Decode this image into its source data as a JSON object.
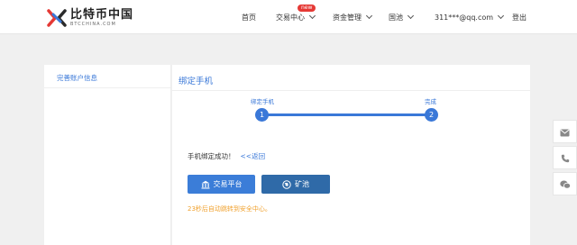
{
  "header": {
    "logo_cn": "比特币中国",
    "logo_en": "BTCCHINA.COM",
    "nav": {
      "home": "首页",
      "trade_center": "交易中心",
      "new_badge": "new",
      "asset_management": "资金管理",
      "pool": "国池",
      "account": "311***@qq.com",
      "logout": "登出"
    }
  },
  "sidebar": {
    "items": [
      {
        "label": "完善账户信息"
      }
    ]
  },
  "main": {
    "title": "绑定手机",
    "steps": [
      {
        "label": "绑定手机",
        "number": "1"
      },
      {
        "label": "完成",
        "number": "2"
      }
    ],
    "success_text": "手机绑定成功！",
    "back_link": "<<返回",
    "buttons": {
      "trade_platform": "交易平台",
      "mining_pool": "矿池"
    },
    "redirect_text": "23秒后自动跳转到安全中心。"
  },
  "colors": {
    "accent": "#3a78d8",
    "button_trade": "#3b7dd8",
    "button_pool": "#2f6aa8",
    "warning_text": "#f0a12e",
    "badge": "#e53935"
  },
  "icons": {
    "logo": "btcchina-x-logo",
    "trade_button": "bank-icon",
    "pool_button": "globe-icon",
    "floaters": [
      "mail-icon",
      "phone-icon",
      "wechat-icon"
    ]
  }
}
